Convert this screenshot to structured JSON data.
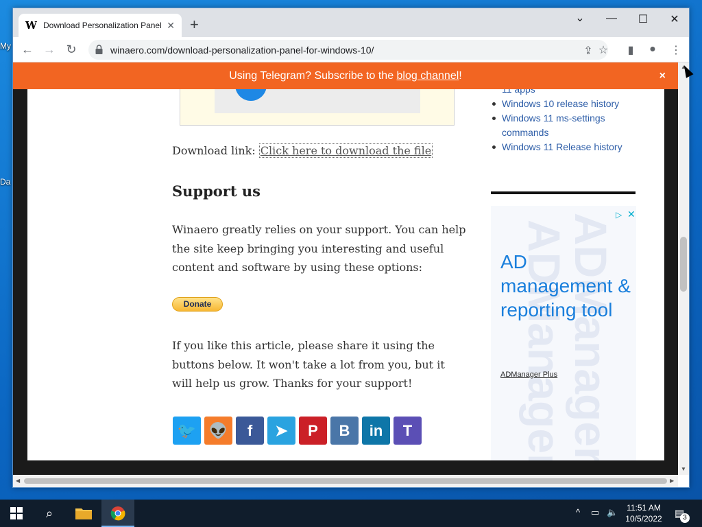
{
  "desktop": {
    "icon_labels": [
      "My",
      "Da"
    ]
  },
  "browser": {
    "tab": {
      "title": "Download Personalization Panel f",
      "favicon": "W",
      "close": "✕"
    },
    "new_tab": "+",
    "window_controls": {
      "chevron": "⌄",
      "minimize": "—",
      "maximize": "☐",
      "close": "✕"
    },
    "url": "winaero.com/download-personalization-panel-for-windows-10/"
  },
  "banner": {
    "prefix": "Using Telegram? Subscribe to the ",
    "link": "blog channel",
    "suffix": "!",
    "close": "×"
  },
  "article": {
    "download_label": "Download link: ",
    "download_link": "Click here to download the file",
    "support_heading": "Support us",
    "support_text": "Winaero greatly relies on your support. You can help the site keep bringing you interesting and useful content and software by using these options:",
    "donate_label": "Donate",
    "share_text": "If you like this article, please share it using the buttons below. It won't take a lot from you, but it will help us grow. Thanks for your support!"
  },
  "share_buttons": [
    {
      "name": "twitter",
      "glyph": "🐦",
      "color": "#1da1f2"
    },
    {
      "name": "reddit",
      "glyph": "👽",
      "color": "#f57c2b"
    },
    {
      "name": "facebook",
      "glyph": "f",
      "color": "#3b5998"
    },
    {
      "name": "telegram",
      "glyph": "➤",
      "color": "#2aa3e0"
    },
    {
      "name": "pinterest",
      "glyph": "P",
      "color": "#cb2027"
    },
    {
      "name": "vkontakte",
      "glyph": "B",
      "color": "#4a76a8"
    },
    {
      "name": "linkedin",
      "glyph": "in",
      "color": "#0e76a8"
    },
    {
      "name": "teams",
      "glyph": "T",
      "color": "#5b4fb5"
    }
  ],
  "sidebar": {
    "prev_tail": "11 apps",
    "links": [
      "Windows 10 release history",
      "Windows 11 ms-settings commands",
      "Windows 11 Release history"
    ]
  },
  "ad": {
    "background_text": "ADManager P",
    "headline": "AD management & reporting tool",
    "brand": "ADManager Plus"
  },
  "taskbar": {
    "time": "11:51 AM",
    "date": "10/5/2022",
    "notifications": "3"
  }
}
